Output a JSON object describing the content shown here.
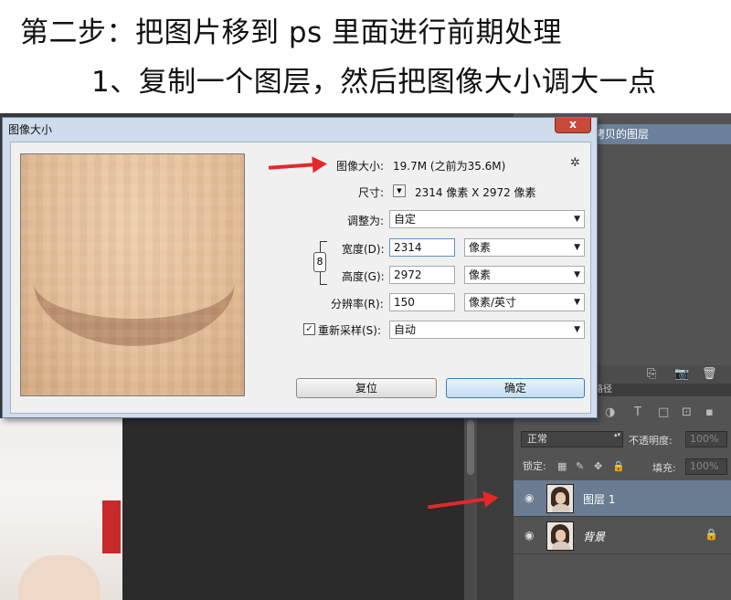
{
  "heading": {
    "line1": "第二步：把图片移到 ps 里面进行前期处理",
    "line2": "1、复制一个图层，然后把图像大小调大一点"
  },
  "history": {
    "item_label": "拷贝的图层"
  },
  "layers_panel": {
    "tab_label": "路径",
    "filter_icons": [
      "T",
      "□",
      "⊡",
      "▪"
    ],
    "blend_mode": "正常",
    "opacity_label": "不透明度:",
    "opacity_value": "100%",
    "lock_label": "锁定:",
    "fill_label": "填充:",
    "fill_value": "100%",
    "layers": [
      {
        "name": "图层 1",
        "selected": true
      },
      {
        "name": "背景",
        "selected": false,
        "locked": true
      }
    ]
  },
  "dialog": {
    "title": "图像大小",
    "close_label": "x",
    "image_size_label": "图像大小:",
    "image_size_value": "19.7M (之前为35.6M)",
    "dimensions_label": "尺寸:",
    "dimensions_value": "2314 像素  X  2972 像素",
    "fit_to_label": "调整为:",
    "fit_to_value": "自定",
    "width_label": "宽度(D):",
    "width_value": "2314",
    "width_unit": "像素",
    "height_label": "高度(G):",
    "height_value": "2972",
    "height_unit": "像素",
    "resolution_label": "分辨率(R):",
    "resolution_value": "150",
    "resolution_unit": "像素/英寸",
    "resample_label": "重新采样(S):",
    "resample_checked": true,
    "resample_value": "自动",
    "reset_label": "复位",
    "ok_label": "确定"
  },
  "colors": {
    "arrow": "#e4282a",
    "selected_layer": "#6a7c92",
    "dialog_frame": "#cfdcec"
  }
}
